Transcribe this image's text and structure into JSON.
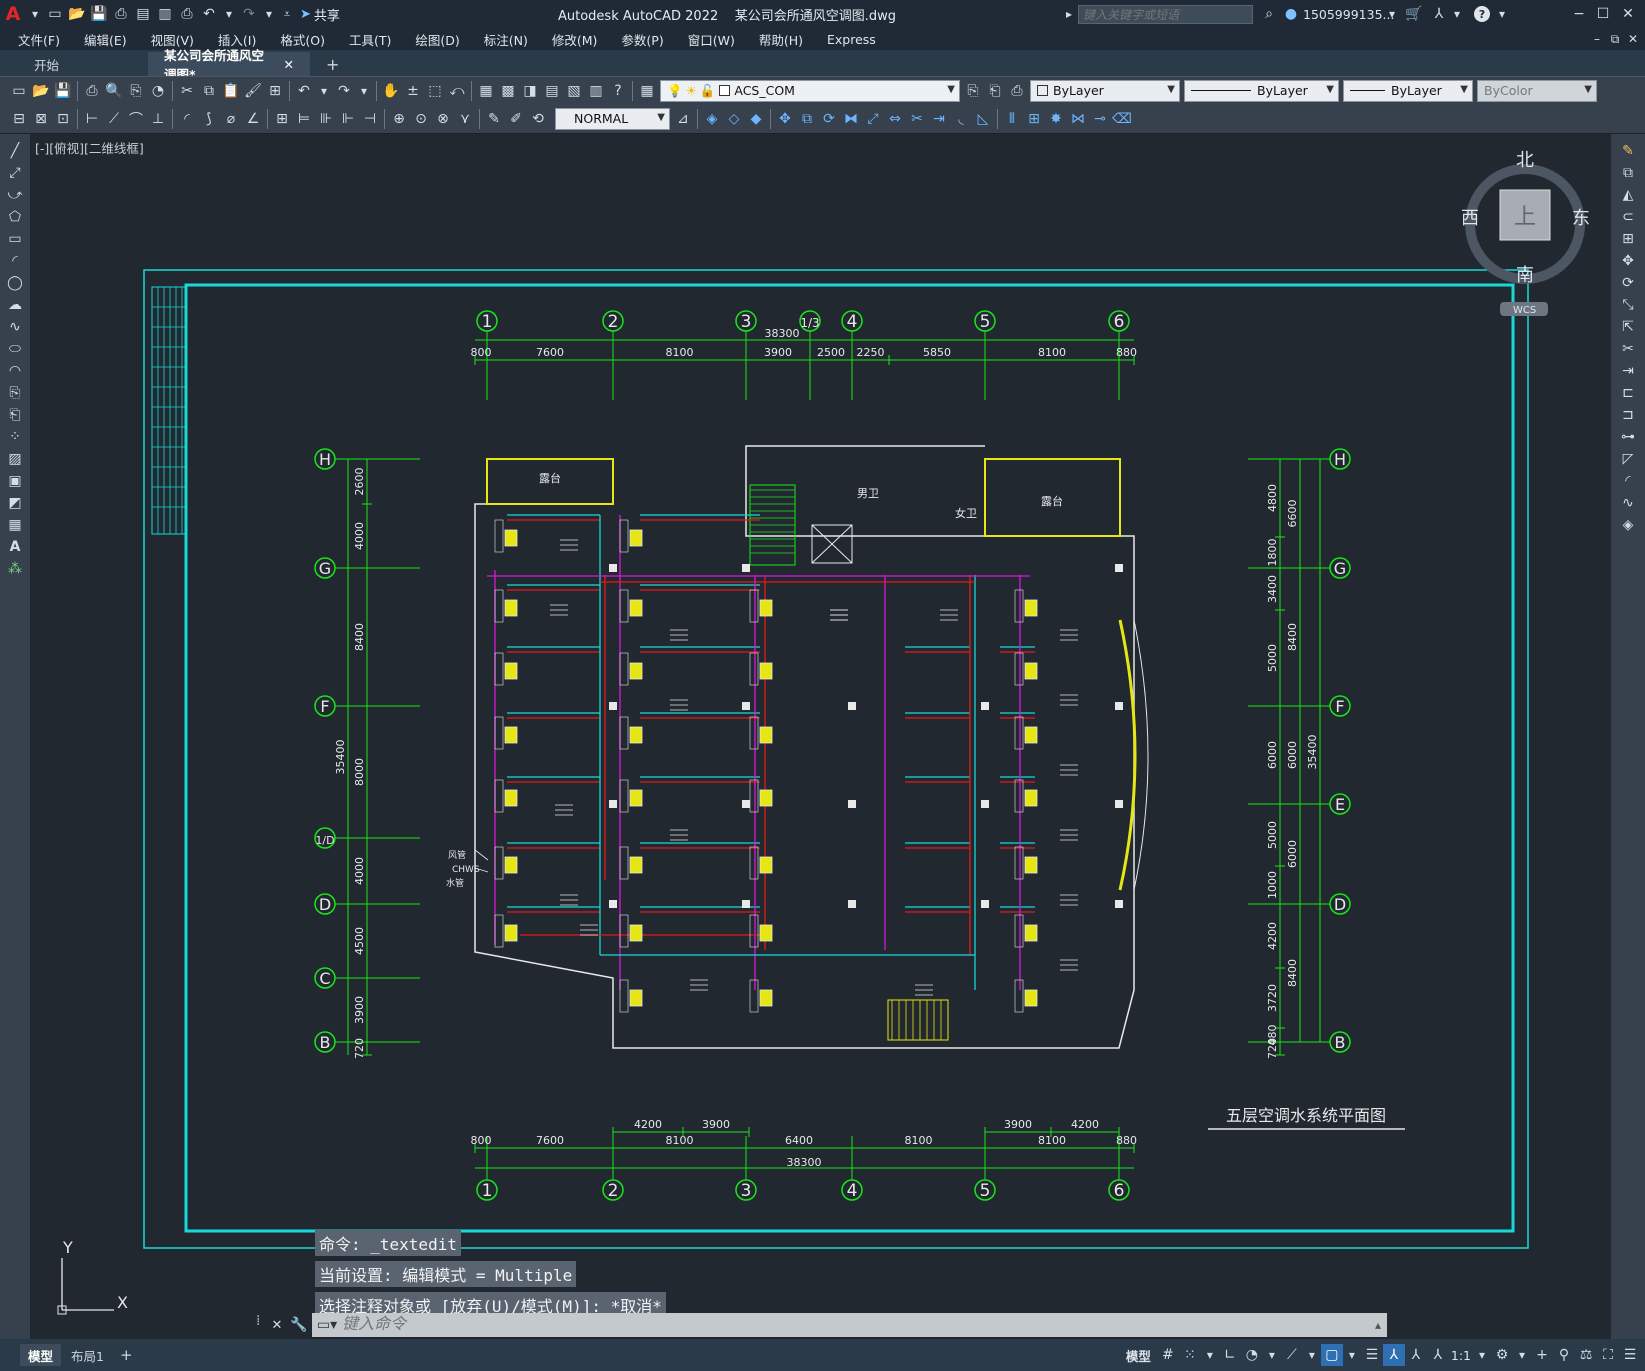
{
  "titlebar": {
    "app_letter": "A",
    "share_label": "共享",
    "title": "Autodesk AutoCAD 2022    某公司会所通风空调图.dwg",
    "search_placeholder": "键入关键字或短语",
    "user": "1505999135...",
    "help": "?"
  },
  "menu": [
    "文件(F)",
    "编辑(E)",
    "视图(V)",
    "插入(I)",
    "格式(O)",
    "工具(T)",
    "绘图(D)",
    "标注(N)",
    "修改(M)",
    "参数(P)",
    "窗口(W)",
    "帮助(H)",
    "Express"
  ],
  "tabs": {
    "start": "开始",
    "doc": "某公司会所通风空调图*",
    "plus": "+"
  },
  "toolbar": {
    "layer": "ACS_COM",
    "color": "ByLayer",
    "linetype": "ByLayer",
    "lineweight": "ByLayer",
    "plotstyle": "ByColor",
    "dimstyle": "NORMAL"
  },
  "viewport": {
    "label": "[-][俯视][二维线框]"
  },
  "viewcube": {
    "north": "北",
    "south": "南",
    "east": "东",
    "west": "西",
    "top": "上",
    "wcs": "WCS"
  },
  "drawing": {
    "title": "五层空调水系统平面图",
    "grid_cols": [
      "1",
      "2",
      "3",
      "1/3",
      "4",
      "5",
      "6"
    ],
    "grid_rows": [
      "H",
      "G",
      "F",
      "1/D",
      "D",
      "C",
      "B"
    ],
    "grid_rows_right": [
      "H",
      "G",
      "F",
      "E",
      "D",
      "B"
    ],
    "top_total": "38300",
    "top_dims": [
      "800",
      "7600",
      "8100",
      "3900",
      "2500",
      "2250",
      "5850",
      "8100",
      "880"
    ],
    "bottom_dims": [
      "800",
      "7600",
      "8100",
      "6400",
      "8100",
      "8100",
      "880"
    ],
    "bottom_sub_left": [
      "4200",
      "3900"
    ],
    "bottom_sub_right": [
      "3900",
      "4200"
    ],
    "bottom_total": "38300",
    "left_dims": [
      "2600",
      "4000",
      "8400",
      "8000",
      "4000",
      "4500",
      "3900",
      "720"
    ],
    "left_total": "35400",
    "right_dims_a": [
      "4800",
      "1800",
      "3400",
      "5000",
      "6000",
      "5000",
      "1000",
      "4200",
      "3720",
      "480",
      "720"
    ],
    "right_dims_b": [
      "6600",
      "8400",
      "6000",
      "6000",
      "8400"
    ],
    "right_total": "35400",
    "rooms": {
      "balcony": "露台",
      "male_wc": "男卫",
      "female_wc": "女卫"
    },
    "labels": {
      "chw": "CHWS",
      "wind": "风管",
      "water": "水管"
    }
  },
  "command": {
    "history": [
      "命令: _textedit",
      "当前设置: 编辑模式 = Multiple",
      "选择注释对象或 [放弃(U)/模式(M)]: *取消*"
    ],
    "placeholder": "键入命令"
  },
  "ucs": {
    "x": "X",
    "y": "Y"
  },
  "status": {
    "tab_model": "模型",
    "tab_layout": "布局1",
    "plus": "+",
    "model_btn": "模型",
    "scale": "1:1"
  }
}
